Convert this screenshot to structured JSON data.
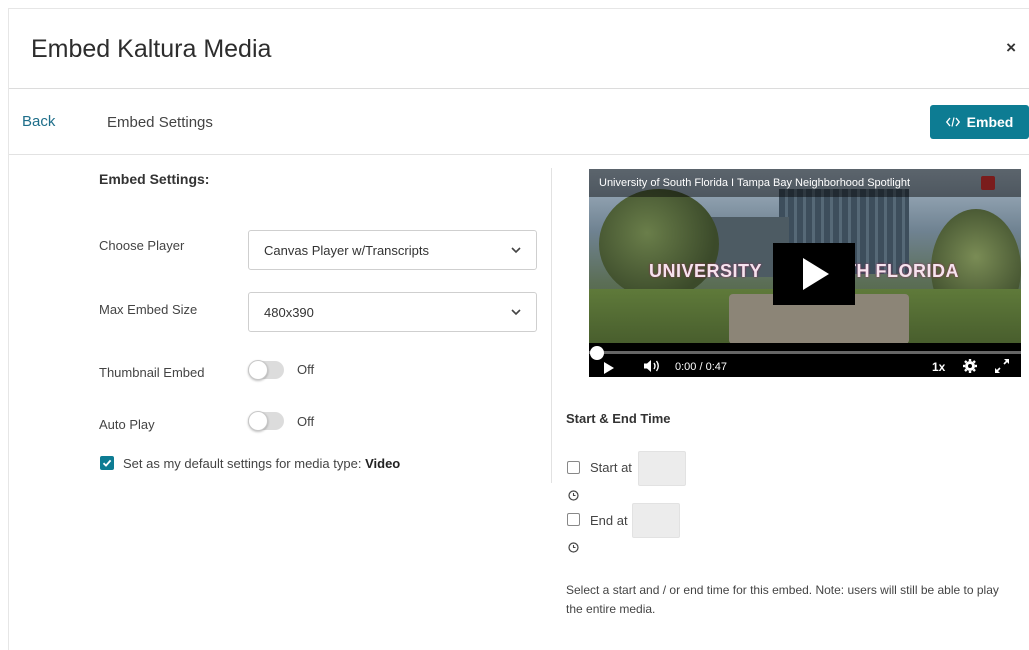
{
  "dialog": {
    "title": "Embed Kaltura Media",
    "close_label": "×"
  },
  "nav": {
    "back_label": "Back",
    "title": "Embed Settings",
    "embed_button_label": "Embed"
  },
  "settings": {
    "section_label": "Embed Settings:",
    "choose_player": {
      "label": "Choose Player",
      "value": "Canvas Player w/Transcripts"
    },
    "max_embed_size": {
      "label": "Max Embed Size",
      "value": "480x390"
    },
    "thumbnail_embed": {
      "label": "Thumbnail Embed",
      "state_text": "Off",
      "on": false
    },
    "auto_play": {
      "label": "Auto Play",
      "state_text": "Off",
      "on": false
    },
    "default_settings": {
      "label": "Set as my default settings for media type:",
      "media_type": "Video",
      "checked": true
    }
  },
  "player": {
    "video_title": "University of South Florida I Tampa Bay Neighborhood Spotlight",
    "overlay_left": "UNIVERSITY",
    "overlay_right": "TH FLORIDA",
    "current_time": "0:00",
    "duration": "/ 0:47",
    "speed": "1x",
    "progress": 0
  },
  "start_end": {
    "title": "Start & End Time",
    "start_label": "Start at",
    "end_label": "End at",
    "start_checked": false,
    "end_checked": false,
    "note": "Select a start and / or end time for this embed. Note: users will still be able to play the entire media."
  },
  "colors": {
    "accent": "#0d7c93",
    "link": "#1e6e8a"
  },
  "icons": [
    "close-icon",
    "code-icon",
    "chevron-down-icon",
    "checkmark-icon",
    "play-icon",
    "volume-icon",
    "gear-icon",
    "fullscreen-icon",
    "clock-icon"
  ]
}
